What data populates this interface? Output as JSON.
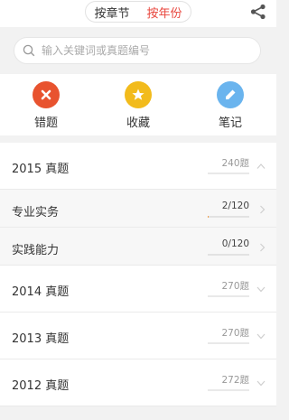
{
  "header": {
    "tabs": [
      {
        "label": "按章节",
        "active": false
      },
      {
        "label": "按年份",
        "active": true
      }
    ],
    "share_icon": "share-icon",
    "active_color": "#e8453c"
  },
  "search": {
    "placeholder": "输入关键词或真题编号",
    "icon": "search-icon"
  },
  "actions": [
    {
      "label": "错题",
      "icon": "close-icon",
      "color": "#e8532f"
    },
    {
      "label": "收藏",
      "icon": "star-icon",
      "color": "#f2bb1c"
    },
    {
      "label": "笔记",
      "icon": "pencil-icon",
      "color": "#6ab4ee"
    }
  ],
  "list": {
    "year_2015": {
      "title": "2015 真题",
      "count": "240题",
      "expanded": true,
      "progress": 0
    },
    "subs": [
      {
        "title": "专业实务",
        "count": "2/120",
        "progress": 0.0167
      },
      {
        "title": "实践能力",
        "count": "0/120",
        "progress": 0
      }
    ],
    "year_2014": {
      "title": "2014 真题",
      "count": "270题",
      "expanded": false,
      "progress": 0
    },
    "year_2013": {
      "title": "2013 真题",
      "count": "270题",
      "expanded": false,
      "progress": 0
    },
    "year_2012": {
      "title": "2012 真题",
      "count": "272题",
      "expanded": false,
      "progress": 0
    }
  }
}
